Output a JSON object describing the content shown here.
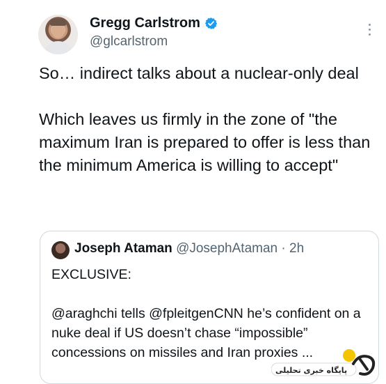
{
  "author": {
    "name": "Gregg Carlstrom",
    "handle": "@glcarlstrom",
    "verified": true
  },
  "tweet": {
    "text": "So… indirect talks about a nuclear-only deal\n\nWhich leaves us firmly in the zone of \"the maximum Iran is prepared to offer is less than the minimum America is willing to accept\""
  },
  "quoted_tweet": {
    "author_name": "Joseph Ataman",
    "author_handle": "@JosephAtaman",
    "separator": "·",
    "time": "2h",
    "text": "EXCLUSIVE:\n\n@araghchi tells @fpleitgenCNN he’s confident on a nuke deal if US doesn’t chase “impossible” concessions on missiles and Iran proxies ..."
  },
  "watermark": {
    "logo_text": "پایگاه خبری تحلیلی"
  },
  "colors": {
    "verified": "#1d9bf0",
    "secondary_text": "#536471",
    "border": "#cfd9de",
    "watermark_yellow": "#f5c400"
  },
  "icons": {
    "verified": "verified-badge-icon",
    "more": "more-vertical-icon"
  }
}
